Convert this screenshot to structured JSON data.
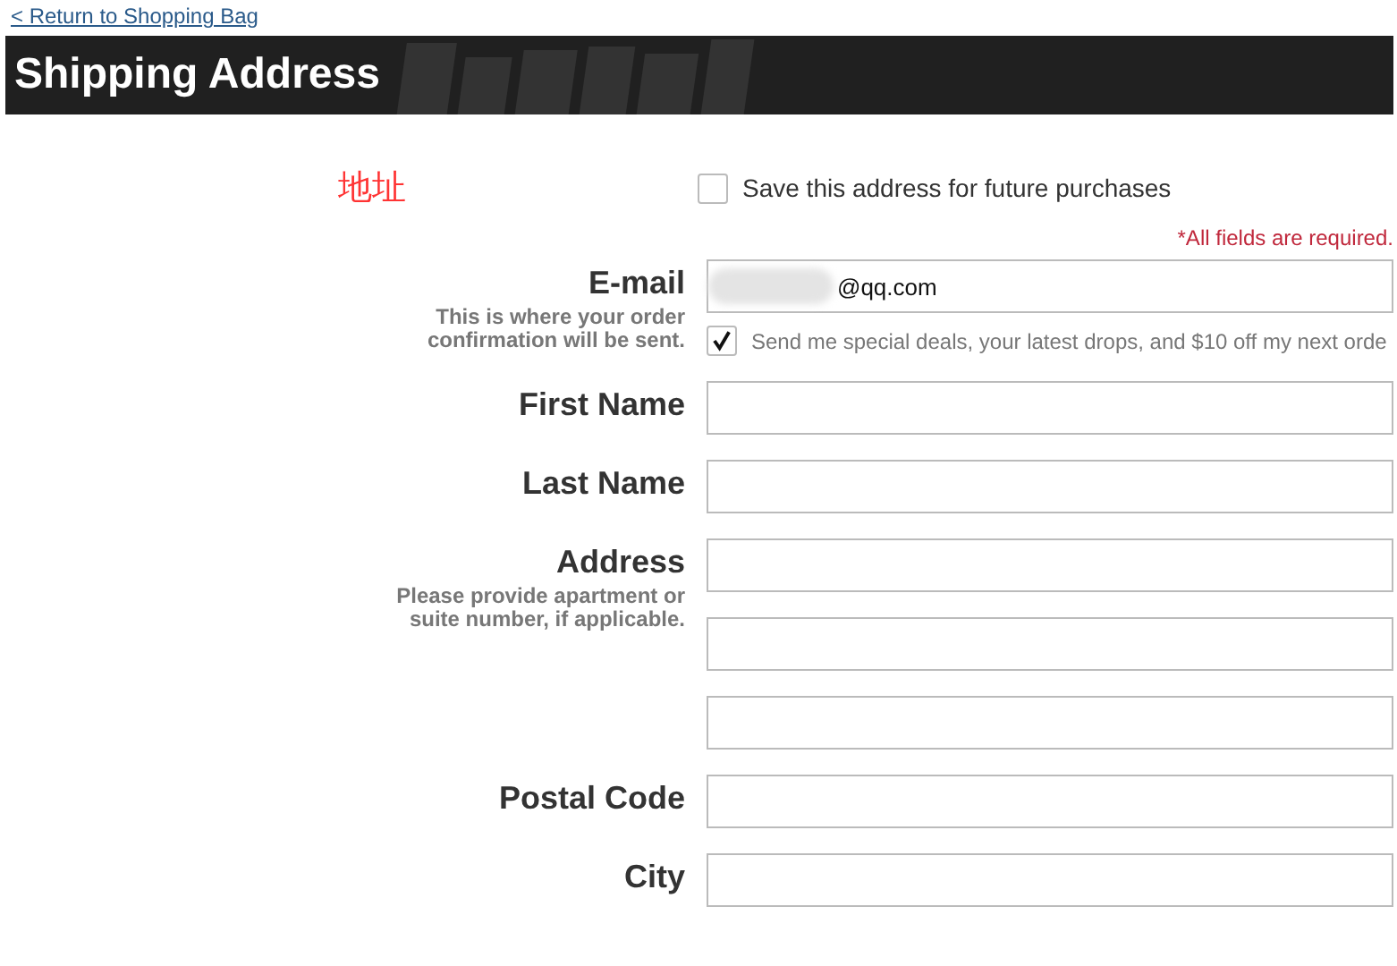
{
  "back_link": "< Return to Shopping Bag",
  "header": {
    "title": "Shipping Address"
  },
  "note": "地址",
  "save_option": {
    "label": "Save this address for future purchases",
    "checked": false
  },
  "required_note": "*All fields are required.",
  "fields": [
    {
      "label": "E-mail",
      "hint": "This is where your order confirmation will be sent.",
      "inputs": [
        {
          "kind": "text",
          "value": "@qq.com",
          "redacted": true
        }
      ],
      "option": {
        "label": "Send me special deals, your latest drops, and $10 off my next orde",
        "checked": true
      }
    },
    {
      "label": "First Name",
      "inputs": [
        {
          "kind": "text"
        }
      ]
    },
    {
      "label": "Last Name",
      "inputs": [
        {
          "kind": "text"
        }
      ]
    },
    {
      "label": "Address",
      "hint": "Please provide apartment or suite number, if applicable.",
      "inputs": [
        {
          "kind": "text"
        },
        {
          "kind": "text"
        },
        {
          "kind": "text"
        }
      ]
    },
    {
      "label": "Postal Code",
      "inputs": [
        {
          "kind": "text"
        }
      ]
    },
    {
      "label": "City",
      "inputs": [
        {
          "kind": "text"
        }
      ]
    }
  ]
}
